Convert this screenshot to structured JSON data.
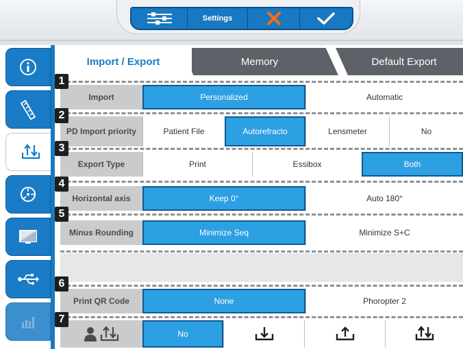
{
  "topbar": {
    "settings_label": "Settings"
  },
  "tabs": [
    {
      "label": "Import / Export",
      "active": true
    },
    {
      "label": "Memory",
      "active": false
    },
    {
      "label": "Default Export",
      "active": false
    }
  ],
  "rows": {
    "import": {
      "number": "1",
      "label": "Import",
      "options": [
        "Personalized",
        "Automatic"
      ],
      "selected": "Personalized"
    },
    "pd_priority": {
      "number": "2",
      "label": "PD Import priority",
      "options": [
        "Patient File",
        "Autorefracto",
        "Lensmeter",
        "No"
      ],
      "selected": "Autorefracto"
    },
    "export_type": {
      "number": "3",
      "label": "Export Type",
      "options": [
        "Print",
        "Essibox",
        "Both"
      ],
      "selected": "Both"
    },
    "horizontal_axis": {
      "number": "4",
      "label": "Horizontal axis",
      "options": [
        "Keep 0°",
        "Auto 180°"
      ],
      "selected": "Keep 0°"
    },
    "minus_rounding": {
      "number": "5",
      "label": "Minus Rounding",
      "options": [
        "Minimize Seq",
        "Minimize S+C"
      ],
      "selected": "Minimize Seq"
    },
    "qr_code": {
      "number": "6",
      "label": "Print QR Code",
      "options": [
        "None",
        "Phoropter 2"
      ],
      "selected": "None"
    },
    "user_transfer": {
      "number": "7",
      "options": [
        "No"
      ],
      "selected": "No"
    }
  },
  "sidebar_icons": [
    "info-icon",
    "ruler-icon",
    "import-export-icon",
    "target-icon",
    "display-icon",
    "usb-icon",
    "chart-icon"
  ],
  "colors": {
    "accent": "#1a7cc6",
    "selected": "#2d9fe3",
    "dark_tab": "#5d6268"
  }
}
